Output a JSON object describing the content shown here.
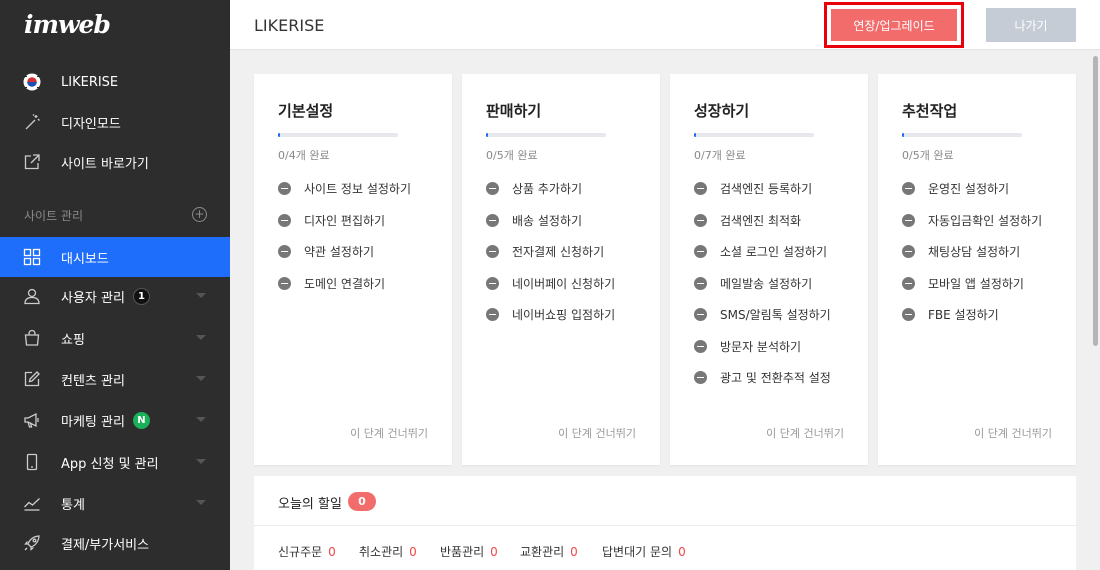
{
  "sidebar": {
    "logo": "imweb",
    "top_items": [
      {
        "label": "LIKERISE",
        "icon": "korea-flag-icon"
      },
      {
        "label": "디자인모드",
        "icon": "magic-wand-icon"
      },
      {
        "label": "사이트 바로가기",
        "icon": "external-link-icon"
      }
    ],
    "section_label": "사이트 관리",
    "section_add": "+",
    "menu": [
      {
        "label": "대시보드",
        "icon": "grid-icon",
        "active": true
      },
      {
        "label": "사용자 관리",
        "icon": "user-icon",
        "badge": "1"
      },
      {
        "label": "쇼핑",
        "icon": "shopping-bag-icon"
      },
      {
        "label": "컨텐츠 관리",
        "icon": "edit-icon"
      },
      {
        "label": "마케팅 관리",
        "icon": "megaphone-icon",
        "badge": "N"
      },
      {
        "label": "App 신청 및 관리",
        "icon": "mobile-icon"
      },
      {
        "label": "통계",
        "icon": "chart-line-icon"
      },
      {
        "label": "결제/부가서비스",
        "icon": "rocket-icon"
      }
    ]
  },
  "header": {
    "site_name": "LIKERISE",
    "upgrade_label": "연장/업그레이드",
    "exit_label": "나가기"
  },
  "cards": [
    {
      "title": "기본설정",
      "progress_text": "0/4개 완료",
      "progress": 0.02,
      "tasks": [
        "사이트 정보 설정하기",
        "디자인 편집하기",
        "약관 설정하기",
        "도메인 연결하기"
      ],
      "skip": "이 단계 건너뛰기"
    },
    {
      "title": "판매하기",
      "progress_text": "0/5개 완료",
      "progress": 0.02,
      "tasks": [
        "상품 추가하기",
        "배송 설정하기",
        "전자결제 신청하기",
        "네이버페이 신청하기",
        "네이버쇼핑 입점하기"
      ],
      "skip": "이 단계 건너뛰기"
    },
    {
      "title": "성장하기",
      "progress_text": "0/7개 완료",
      "progress": 0.02,
      "tasks": [
        "검색엔진 등록하기",
        "검색엔진 최적화",
        "소셜 로그인 설정하기",
        "메일발송 설정하기",
        "SMS/알림톡 설정하기",
        "방문자 분석하기",
        "광고 및 전환추적 설정"
      ],
      "skip": "이 단계 건너뛰기"
    },
    {
      "title": "추천작업",
      "progress_text": "0/5개 완료",
      "progress": 0.02,
      "tasks": [
        "운영진 설정하기",
        "자동입금확인 설정하기",
        "채팅상담 설정하기",
        "모바일 앱 설정하기",
        "FBE 설정하기"
      ],
      "skip": "이 단계 건너뛰기"
    }
  ],
  "today": {
    "title": "오늘의 할일",
    "count": "0",
    "stats": [
      {
        "label": "신규주문",
        "value": "0"
      },
      {
        "label": "취소관리",
        "value": "0"
      },
      {
        "label": "반품관리",
        "value": "0"
      },
      {
        "label": "교환관리",
        "value": "0"
      },
      {
        "label": "답변대기 문의",
        "value": "0"
      }
    ]
  },
  "colors": {
    "sidebar_bg": "#2d2d2d",
    "accent_blue": "#1e6efb",
    "upgrade_red": "#f26c6c",
    "highlight_border": "#e8000b",
    "exit_gray": "#c6ccd6",
    "badge_green": "#1bb05a"
  }
}
